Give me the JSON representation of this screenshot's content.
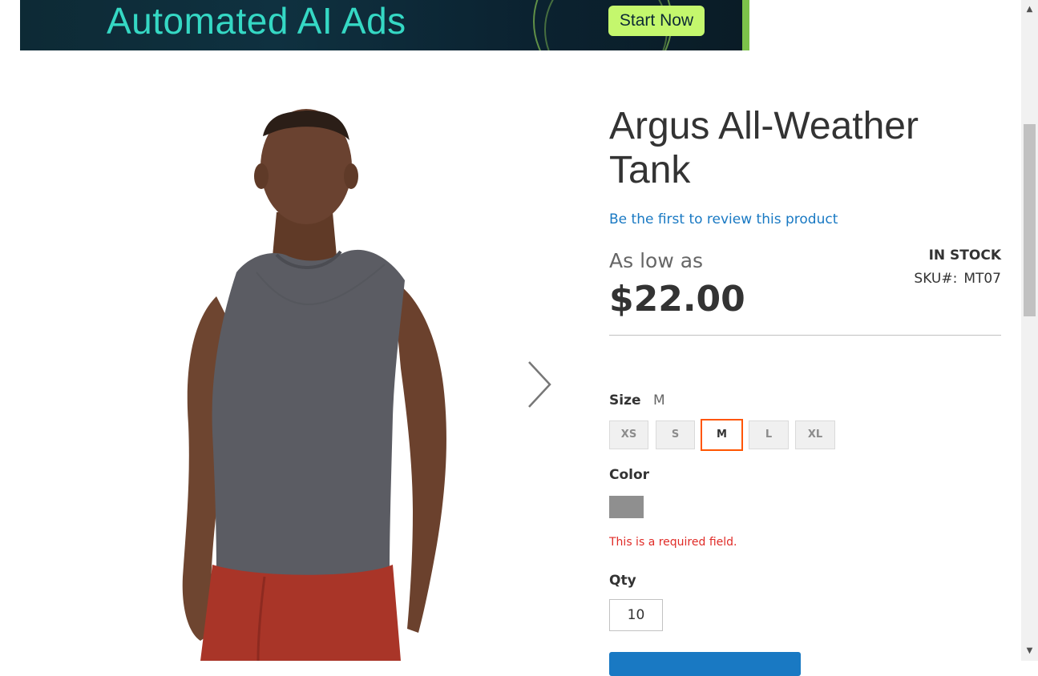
{
  "ad": {
    "title": "Automated AI Ads",
    "button_label": "Start Now",
    "colors": {
      "background": "#0d2a35",
      "title": "#35d8c4",
      "button": "#c4f76d",
      "accent": "#7cc24a"
    }
  },
  "gallery": {
    "image_description_icon": "product-photo-man-grey-tank",
    "next_icon": "chevron-right-icon"
  },
  "product": {
    "title": "Argus All-Weather Tank",
    "review_link": "Be the first to review this product",
    "price_prefix": "As low as",
    "price": "$22.00",
    "stock": "IN STOCK",
    "sku_label": "SKU#:",
    "sku_value": "MT07"
  },
  "options": {
    "size_label": "Size",
    "size_selected": "M",
    "sizes": [
      "XS",
      "S",
      "M",
      "L",
      "XL"
    ],
    "color_label": "Color",
    "color_swatch": "#8f8f8f",
    "error_text": "This is a required field.",
    "qty_label": "Qty",
    "qty_value": "10"
  },
  "colors": {
    "link": "#1979c3",
    "selected_border": "#ff5501",
    "error": "#e02b27"
  }
}
